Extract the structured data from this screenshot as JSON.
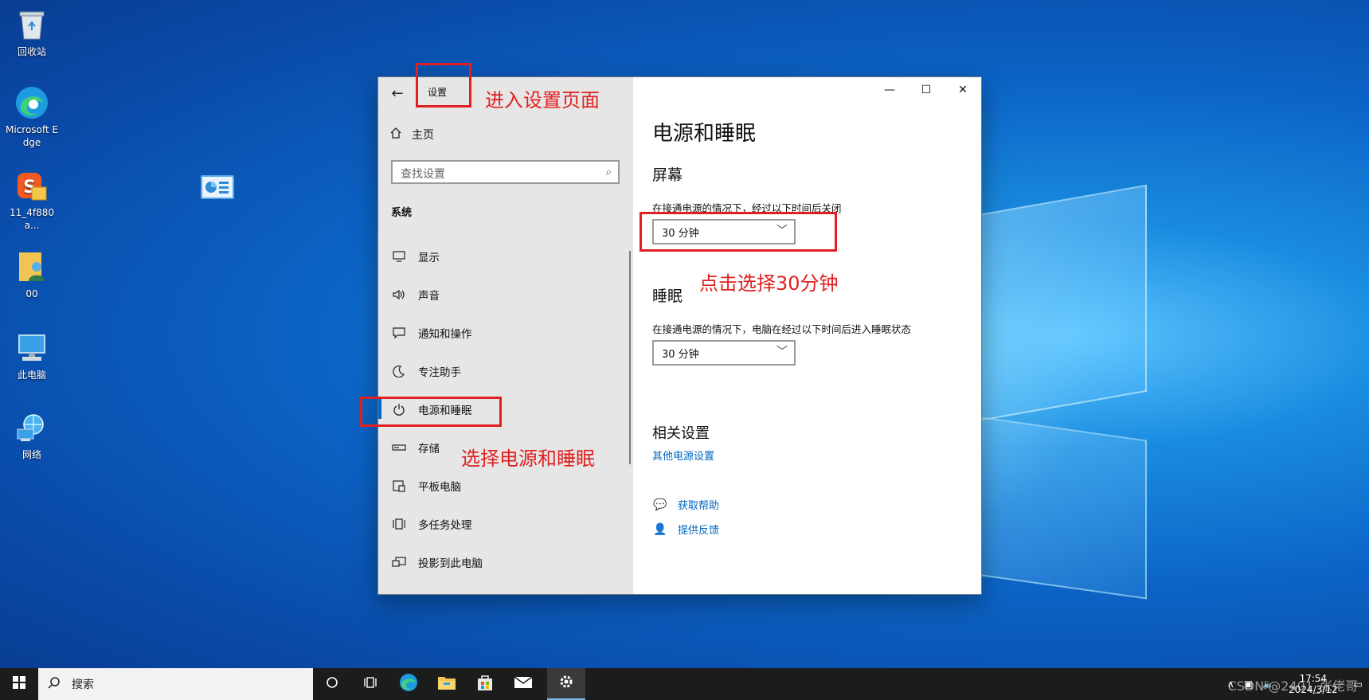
{
  "desktop": {
    "icons": [
      {
        "label": "回收站",
        "icon": "recycle-bin-icon"
      },
      {
        "label": "Microsoft Edge",
        "icon": "edge-icon"
      },
      {
        "label": "11_4f880a...",
        "icon": "sogou-icon"
      },
      {
        "label": "00",
        "icon": "user-folder-icon"
      },
      {
        "label": "此电脑",
        "icon": "computer-icon"
      },
      {
        "label": "网络",
        "icon": "network-icon"
      }
    ]
  },
  "window": {
    "title": "设置",
    "home_label": "主页",
    "search_placeholder": "查找设置",
    "section_header": "系统",
    "nav_items": [
      {
        "label": "显示",
        "icon": "display-icon"
      },
      {
        "label": "声音",
        "icon": "speaker-icon"
      },
      {
        "label": "通知和操作",
        "icon": "notification-icon"
      },
      {
        "label": "专注助手",
        "icon": "moon-icon"
      },
      {
        "label": "电源和睡眠",
        "icon": "power-icon",
        "active": true
      },
      {
        "label": "存储",
        "icon": "storage-icon"
      },
      {
        "label": "平板电脑",
        "icon": "tablet-icon"
      },
      {
        "label": "多任务处理",
        "icon": "multitask-icon"
      },
      {
        "label": "投影到此电脑",
        "icon": "project-icon"
      }
    ],
    "controls": {
      "minimize": "—",
      "maximize": "☐",
      "close": "✕"
    }
  },
  "content": {
    "page_title": "电源和睡眠",
    "screen": {
      "heading": "屏幕",
      "description": "在接通电源的情况下，经过以下时间后关闭",
      "value": "30 分钟"
    },
    "sleep": {
      "heading": "睡眠",
      "description": "在接通电源的情况下，电脑在经过以下时间后进入睡眠状态",
      "value": "30 分钟"
    },
    "related": {
      "heading": "相关设置",
      "link": "其他电源设置"
    },
    "help": {
      "get_help": "获取帮助",
      "feedback": "提供反馈"
    }
  },
  "annotations": {
    "enter_settings": "进入设置页面",
    "click_30": "点击选择30分钟",
    "select_power": "选择电源和睡眠"
  },
  "taskbar": {
    "search_label": "搜索",
    "time": "17:54",
    "date": "2024/3/12",
    "watermark": "CSDN @2401_张佬哥"
  },
  "colors": {
    "accent": "#0067c0",
    "annotation": "#e02020",
    "nav_bg": "#e6e6e6",
    "taskbar_bg": "#1c1c1c"
  }
}
